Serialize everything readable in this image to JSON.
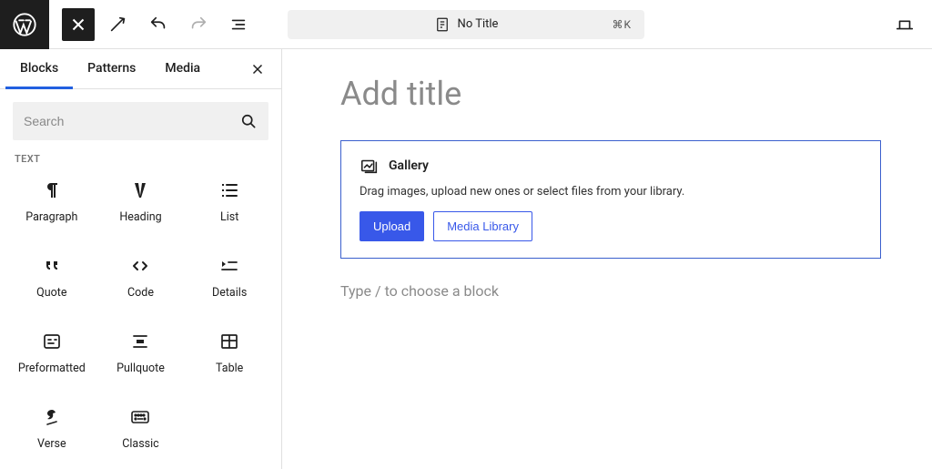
{
  "toolbar": {
    "doc_title": "No Title",
    "shortcut": "⌘K"
  },
  "sidebar": {
    "tabs": [
      "Blocks",
      "Patterns",
      "Media"
    ],
    "active_tab": 0,
    "search_placeholder": "Search",
    "category_label": "TEXT",
    "blocks": [
      {
        "name": "Paragraph",
        "icon": "paragraph-icon"
      },
      {
        "name": "Heading",
        "icon": "heading-icon"
      },
      {
        "name": "List",
        "icon": "list-icon"
      },
      {
        "name": "Quote",
        "icon": "quote-icon"
      },
      {
        "name": "Code",
        "icon": "code-icon"
      },
      {
        "name": "Details",
        "icon": "details-icon"
      },
      {
        "name": "Preformatted",
        "icon": "preformatted-icon"
      },
      {
        "name": "Pullquote",
        "icon": "pullquote-icon"
      },
      {
        "name": "Table",
        "icon": "table-icon"
      },
      {
        "name": "Verse",
        "icon": "verse-icon"
      },
      {
        "name": "Classic",
        "icon": "classic-icon"
      }
    ]
  },
  "canvas": {
    "title_placeholder": "Add title",
    "gallery": {
      "label": "Gallery",
      "description": "Drag images, upload new ones or select files from your library.",
      "upload_label": "Upload",
      "media_library_label": "Media Library"
    },
    "paragraph_placeholder": "Type / to choose a block"
  }
}
